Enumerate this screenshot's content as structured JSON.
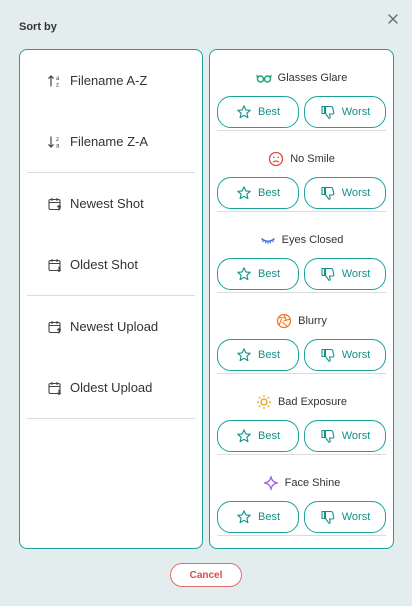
{
  "dialog": {
    "title": "Sort by",
    "close_icon": "close-icon",
    "cancel_label": "Cancel"
  },
  "sort_options": {
    "groups": [
      {
        "items": [
          {
            "label": "Filename A-Z",
            "icon": "sort-alpha-asc-icon"
          },
          {
            "label": "Filename Z-A",
            "icon": "sort-alpha-desc-icon"
          }
        ]
      },
      {
        "items": [
          {
            "label": "Newest Shot",
            "icon": "calendar-up-icon"
          },
          {
            "label": "Oldest Shot",
            "icon": "calendar-down-icon"
          }
        ]
      },
      {
        "items": [
          {
            "label": "Newest Upload",
            "icon": "calendar-up-icon"
          },
          {
            "label": "Oldest Upload",
            "icon": "calendar-down-icon"
          }
        ]
      }
    ]
  },
  "quality_categories": [
    {
      "label": "Glasses Glare",
      "icon": "glasses-icon",
      "color": "#19a36a",
      "best_label": "Best",
      "worst_label": "Worst"
    },
    {
      "label": "No Smile",
      "icon": "frown-icon",
      "color": "#e0473f",
      "best_label": "Best",
      "worst_label": "Worst"
    },
    {
      "label": "Eyes Closed",
      "icon": "closed-eye-icon",
      "color": "#2f6bd8",
      "best_label": "Best",
      "worst_label": "Worst"
    },
    {
      "label": "Blurry",
      "icon": "aperture-icon",
      "color": "#f0761e",
      "best_label": "Best",
      "worst_label": "Worst"
    },
    {
      "label": "Bad Exposure",
      "icon": "sun-icon",
      "color": "#e0a41c",
      "best_label": "Best",
      "worst_label": "Worst"
    },
    {
      "label": "Face Shine",
      "icon": "sparkle-icon",
      "color": "#a35de0",
      "best_label": "Best",
      "worst_label": "Worst"
    }
  ],
  "colors": {
    "accent": "#19a39a",
    "accent_text": "#139088",
    "cancel": "#d94c4c",
    "background": "#e3eded"
  }
}
